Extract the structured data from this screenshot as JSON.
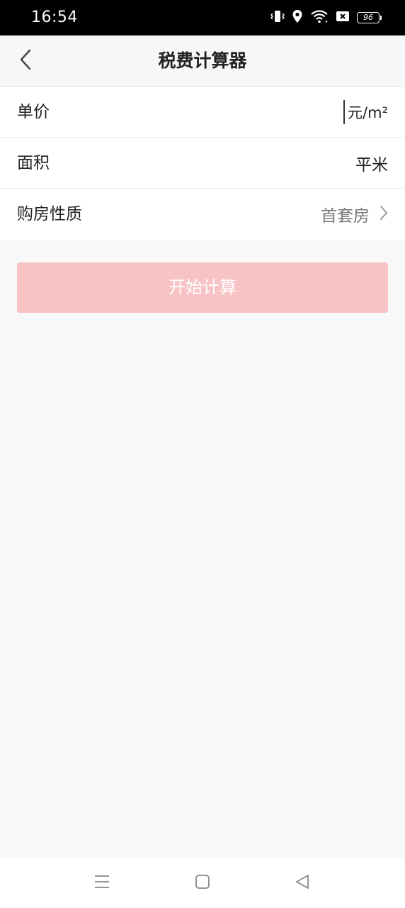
{
  "status_bar": {
    "time": "16:54",
    "battery": "96",
    "icons": [
      "vibrate-icon",
      "location-icon",
      "wifi-icon",
      "sim-off-icon",
      "battery-icon"
    ]
  },
  "nav": {
    "title": "税费计算器",
    "back_icon": "chevron-left-icon"
  },
  "form": {
    "unit_price": {
      "label": "单价",
      "value": "",
      "unit": "元/m²"
    },
    "area": {
      "label": "面积",
      "value": "",
      "unit": "平米"
    },
    "purchase_type": {
      "label": "购房性质",
      "value": "首套房",
      "icon": "chevron-right-icon"
    }
  },
  "calculate_button": {
    "label": "开始计算",
    "color": "#f7c3c5"
  },
  "system_nav": {
    "icons": [
      "menu-icon",
      "home-icon",
      "back-triangle-icon"
    ]
  }
}
